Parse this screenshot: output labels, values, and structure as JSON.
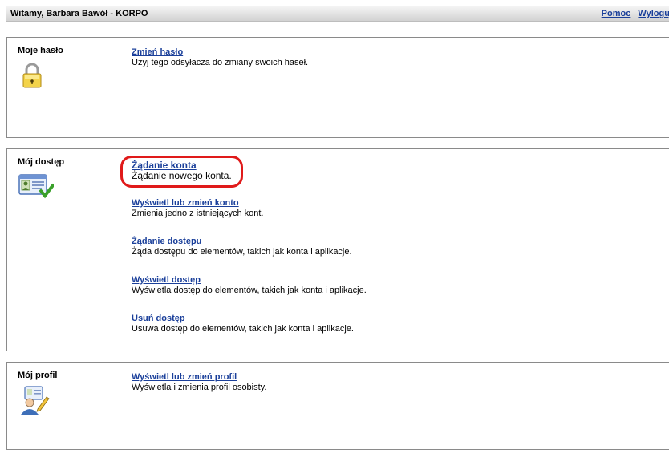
{
  "header": {
    "welcome": "Witamy, Barbara Bawół - KORPO",
    "help": "Pomoc",
    "logout": "Wyloguj"
  },
  "sections": [
    {
      "title": "Moje hasło",
      "icon": "padlock-icon",
      "items": [
        {
          "link": "Zmień hasło",
          "desc": "Użyj tego odsyłacza do zmiany swoich haseł."
        }
      ]
    },
    {
      "title": "Mój dostęp",
      "icon": "id-card-check-icon",
      "items": [
        {
          "link": "Żądanie konta",
          "desc": "Żądanie nowego konta."
        },
        {
          "link": "Wyświetl lub zmień konto",
          "desc": "Zmienia jedno z istniejących kont."
        },
        {
          "link": "Żądanie dostępu",
          "desc": "Żąda dostępu do elementów, takich jak konta i aplikacje."
        },
        {
          "link": "Wyświetl dostęp",
          "desc": "Wyświetla dostęp do elementów, takich jak konta i aplikacje."
        },
        {
          "link": "Usuń dostęp",
          "desc": "Usuwa dostęp do elementów, takich jak konta i aplikacje."
        }
      ]
    },
    {
      "title": "Mój profil",
      "icon": "profile-edit-icon",
      "items": [
        {
          "link": "Wyświetl lub zmień profil",
          "desc": "Wyświetla i zmienia profil osobisty."
        }
      ]
    }
  ],
  "colors": {
    "link": "#1a3f9a",
    "highlight": "#e01a1a"
  }
}
